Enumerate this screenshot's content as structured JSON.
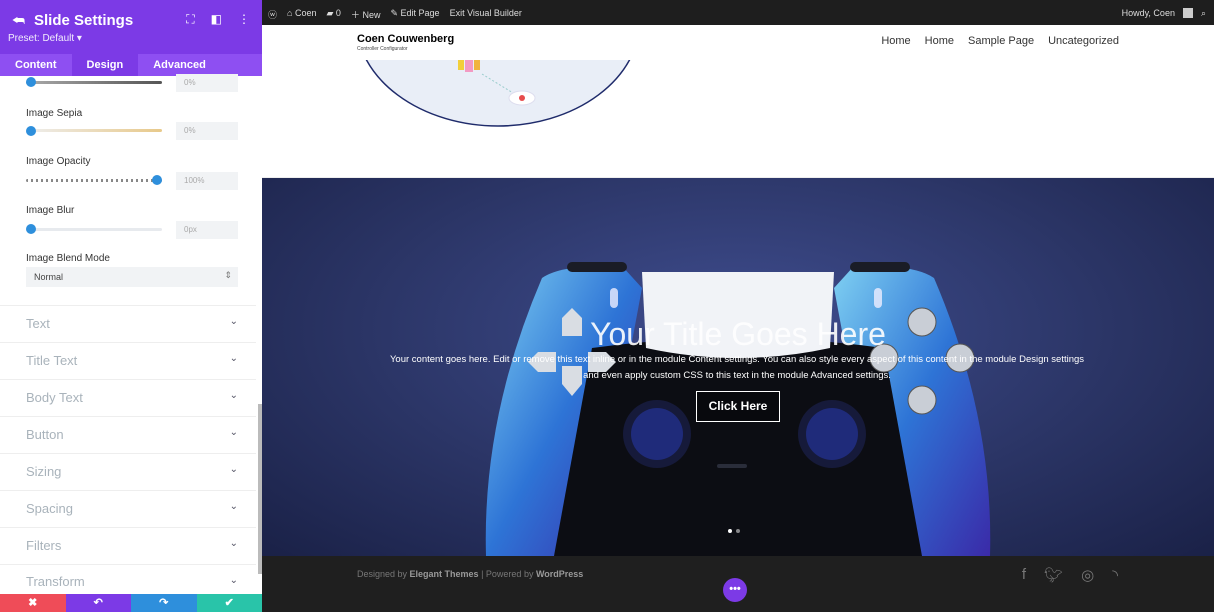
{
  "panel": {
    "title": "Slide Settings",
    "preset": "Preset: Default ▾",
    "tabs": [
      "Content",
      "Design",
      "Advanced"
    ],
    "settings": {
      "top_value": "0%",
      "sepia_label": "Image Sepia",
      "sepia_value": "0%",
      "sepia_level": 0,
      "opacity_label": "Image Opacity",
      "opacity_value": "100%",
      "opacity_level": 100,
      "blur_label": "Image Blur",
      "blur_value": "0px",
      "blur_level": 0,
      "blend_label": "Image Blend Mode",
      "blend_value": "Normal"
    },
    "groups": [
      "Text",
      "Title Text",
      "Body Text",
      "Button",
      "Sizing",
      "Spacing",
      "Filters",
      "Transform"
    ],
    "footer_colors": [
      "#ef4c58",
      "#7c3ae6",
      "#2e8fdc",
      "#29c4a9"
    ],
    "footer_icons": [
      "close-icon",
      "undo-icon",
      "redo-icon",
      "check-icon"
    ]
  },
  "adminbar": {
    "items": [
      "Coen",
      "0",
      "New",
      "Edit Page",
      "Exit Visual Builder"
    ],
    "greeting": "Howdy, Coen"
  },
  "site": {
    "brand": "Coen Couwenberg",
    "tagline": "Controller Configurator",
    "nav": [
      "Home",
      "Home",
      "Sample Page",
      "Uncategorized"
    ]
  },
  "hero": {
    "title": "Your Title Goes Here",
    "content": "Your content goes here. Edit or remove this text inline or in the module Content settings. You can also style every aspect of this content in the module Design settings and even apply custom CSS to this text in the module Advanced settings.",
    "button": "Click Here",
    "active_slide": 1,
    "slide_count": 2
  },
  "footer": {
    "credit_prefix": "Designed by ",
    "credit_theme": "Elegant Themes",
    "credit_mid": " | Powered by ",
    "credit_wp": "WordPress",
    "social": [
      "facebook-icon",
      "twitter-icon",
      "instagram-icon",
      "rss-icon"
    ]
  },
  "colors": {
    "accent": "#7c3ae6",
    "slider_knob": "#2e8fdc",
    "hero_bg": "#2b3566"
  }
}
